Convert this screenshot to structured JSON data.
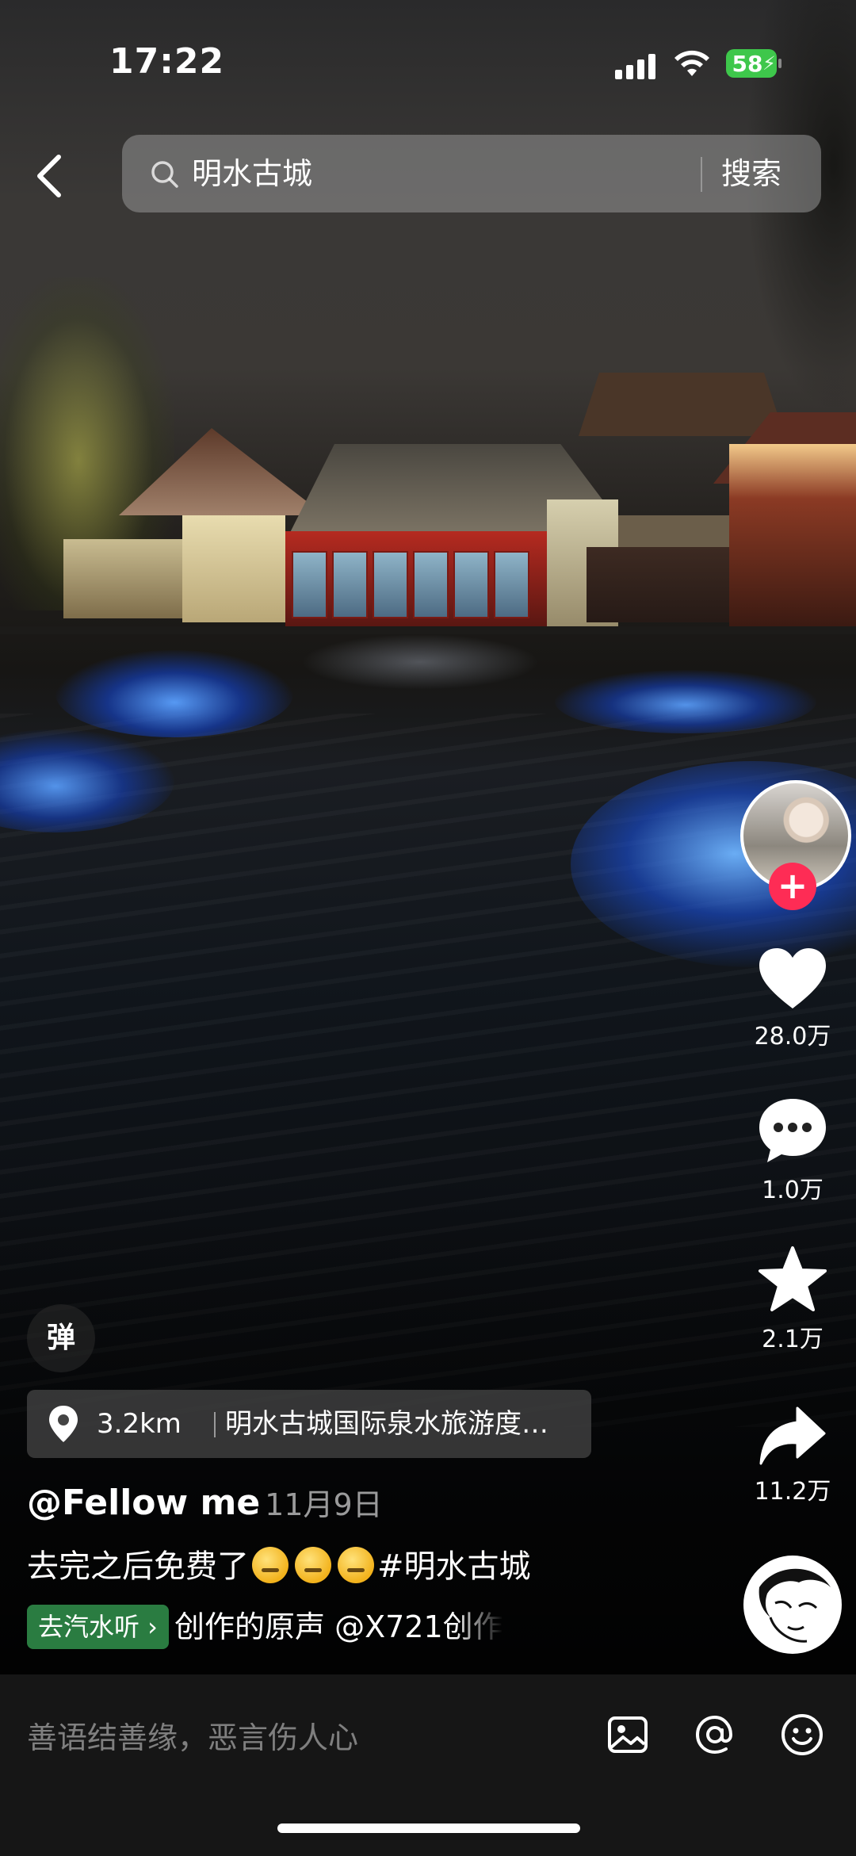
{
  "status_bar": {
    "time": "17:22",
    "battery": "58"
  },
  "search": {
    "query": "明水古城",
    "button_label": "搜索"
  },
  "rail": {
    "likes": "28.0万",
    "comments": "1.0万",
    "favorites": "2.1万",
    "shares": "11.2万",
    "follow_symbol": "+"
  },
  "danmaku_label": "弹",
  "location": {
    "distance": "3.2km",
    "name": "明水古城国际泉水旅游度…"
  },
  "post": {
    "username": "@Fellow me",
    "date": "· 11月9日",
    "caption_prefix": "去完之后免费了",
    "hashtag": "#明水古城"
  },
  "music": {
    "chip_label": "去汽水听 ›",
    "text": "创作的原声    @X721创作"
  },
  "comment_bar": {
    "placeholder": "善语结善缘，恶言伤人心"
  },
  "colors": {
    "accent_red": "#fe2c55",
    "battery_green": "#3ec74b",
    "music_chip": "#2f8a48"
  },
  "icons": [
    "back-arrow-icon",
    "search-icon",
    "location-pin-icon",
    "heart-icon",
    "comment-icon",
    "star-icon",
    "share-icon",
    "image-icon",
    "at-icon",
    "emoji-icon"
  ]
}
